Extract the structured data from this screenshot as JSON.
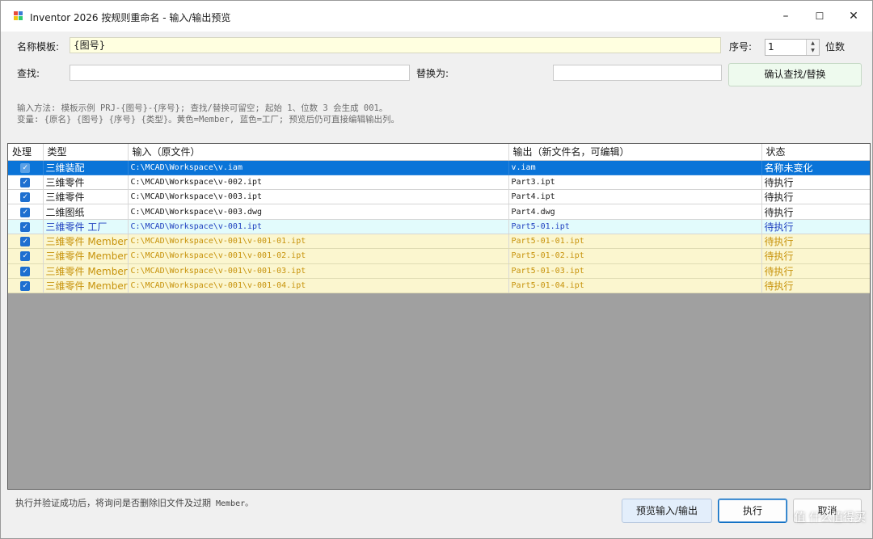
{
  "window": {
    "title": "Inventor 2026 按规则重命名 - 输入/输出预览",
    "minimize": "–",
    "maximize": "☐",
    "close": "✕"
  },
  "form": {
    "template_label": "名称模板:",
    "template_value": "{图号}",
    "seq_label": "序号:",
    "seq_value": "1",
    "digits_label": "位数",
    "find_label": "查找:",
    "find_value": "",
    "replace_label": "替换为:",
    "replace_value": "",
    "confirm_button": "确认查找/替换"
  },
  "hints": {
    "line1": "输入方法: 模板示例 PRJ-{图号}-{序号}; 查找/替换可留空; 起始 1、位数 3 会生成 001。",
    "line2": "变量: {原名}  {图号}  {序号}  {类型}。黄色=Member, 蓝色=工厂; 预览后仍可直接编辑输出列。"
  },
  "table": {
    "columns": [
      "处理",
      "类型",
      "输入（原文件）",
      "输出（新文件名，可编辑）",
      "状态"
    ],
    "rows": [
      {
        "checked": "✓",
        "type": "三维装配",
        "input": "C:\\MCAD\\Workspace\\v.iam",
        "output": "v.iam",
        "status": "名称未变化",
        "style": "sel"
      },
      {
        "checked": "✓",
        "type": "三维零件",
        "input": "C:\\MCAD\\Workspace\\v-002.ipt",
        "output": "Part3.ipt",
        "status": "待执行",
        "style": "norm"
      },
      {
        "checked": "✓",
        "type": "三维零件",
        "input": "C:\\MCAD\\Workspace\\v-003.ipt",
        "output": "Part4.ipt",
        "status": "待执行",
        "style": "norm"
      },
      {
        "checked": "✓",
        "type": "二维图纸",
        "input": "C:\\MCAD\\Workspace\\v-003.dwg",
        "output": "Part4.dwg",
        "status": "待执行",
        "style": "norm"
      },
      {
        "checked": "✓",
        "type": "三维零件 工厂",
        "input": "C:\\MCAD\\Workspace\\v-001.ipt",
        "output": "Part5-01.ipt",
        "status": "待执行",
        "style": "factory"
      },
      {
        "checked": "✓",
        "type": "三维零件 Member",
        "input": "C:\\MCAD\\Workspace\\v-001\\v-001-01.ipt",
        "output": "Part5-01-01.ipt",
        "status": "待执行",
        "style": "member"
      },
      {
        "checked": "✓",
        "type": "三维零件 Member",
        "input": "C:\\MCAD\\Workspace\\v-001\\v-001-02.ipt",
        "output": "Part5-01-02.ipt",
        "status": "待执行",
        "style": "member"
      },
      {
        "checked": "✓",
        "type": "三维零件 Member",
        "input": "C:\\MCAD\\Workspace\\v-001\\v-001-03.ipt",
        "output": "Part5-01-03.ipt",
        "status": "待执行",
        "style": "member"
      },
      {
        "checked": "✓",
        "type": "三维零件 Member",
        "input": "C:\\MCAD\\Workspace\\v-001\\v-001-04.ipt",
        "output": "Part5-01-04.ipt",
        "status": "待执行",
        "style": "member"
      }
    ]
  },
  "footer": {
    "message_prefix": "执行并验证成功后，将询问是否删除旧文件及过期",
    "message_member": " Member。",
    "preview_button": "预览输入/输出",
    "execute_button": "执行",
    "cancel_button": "取消",
    "watermark": "值 什么值得买"
  },
  "colors": {
    "selected_row": "#0a74d8",
    "member_row": "#fbf6cf",
    "factory_row": "#e2fbfc",
    "template_field": "#ffffe0",
    "grid_background": "#a0a0a0"
  }
}
